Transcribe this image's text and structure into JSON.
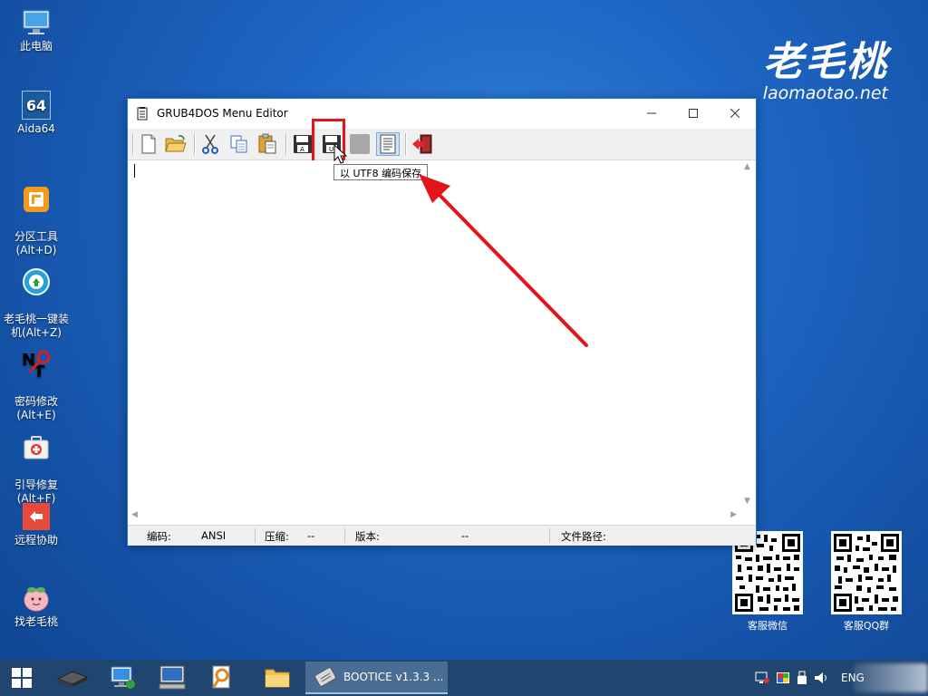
{
  "desktop": {
    "icons": [
      {
        "label": "此电脑"
      },
      {
        "label": "Aida64"
      },
      {
        "label": "分区工具\n(Alt+D)"
      },
      {
        "label": "老毛桃一键装\n机(Alt+Z)"
      },
      {
        "label": "密码修改\n(Alt+E)"
      },
      {
        "label": "引导修复\n(Alt+F)"
      },
      {
        "label": "远程协助"
      },
      {
        "label": "找老毛桃"
      }
    ],
    "aida_icon_text": "64",
    "brand_cn": "老毛桃",
    "brand_url": "laomaotao.net",
    "qr_left_label": "客服微信",
    "qr_right_label": "客服QQ群"
  },
  "window": {
    "title": "GRUB4DOS Menu Editor",
    "toolbar": {
      "buttons": [
        "new",
        "open",
        "cut",
        "copy",
        "paste",
        "save-ansi",
        "save-utf8",
        "disabled",
        "text-mode",
        "exit"
      ]
    },
    "tooltip": "以 UTF8 编码保存",
    "editor_text": "",
    "status": {
      "encoding_label": "编码:",
      "encoding_value": "ANSI",
      "compress_label": "压缩:",
      "compress_value": "--",
      "version_label": "版本:",
      "version_value": "--",
      "filepath_label": "文件路径:"
    }
  },
  "taskbar": {
    "active_app_label": "BOOTICE v1.3.3 ...",
    "language": "ENG"
  },
  "colors": {
    "annotation_red": "#e4141b",
    "titlebar_border": "#1979ca",
    "taskbar": "#20456e"
  }
}
